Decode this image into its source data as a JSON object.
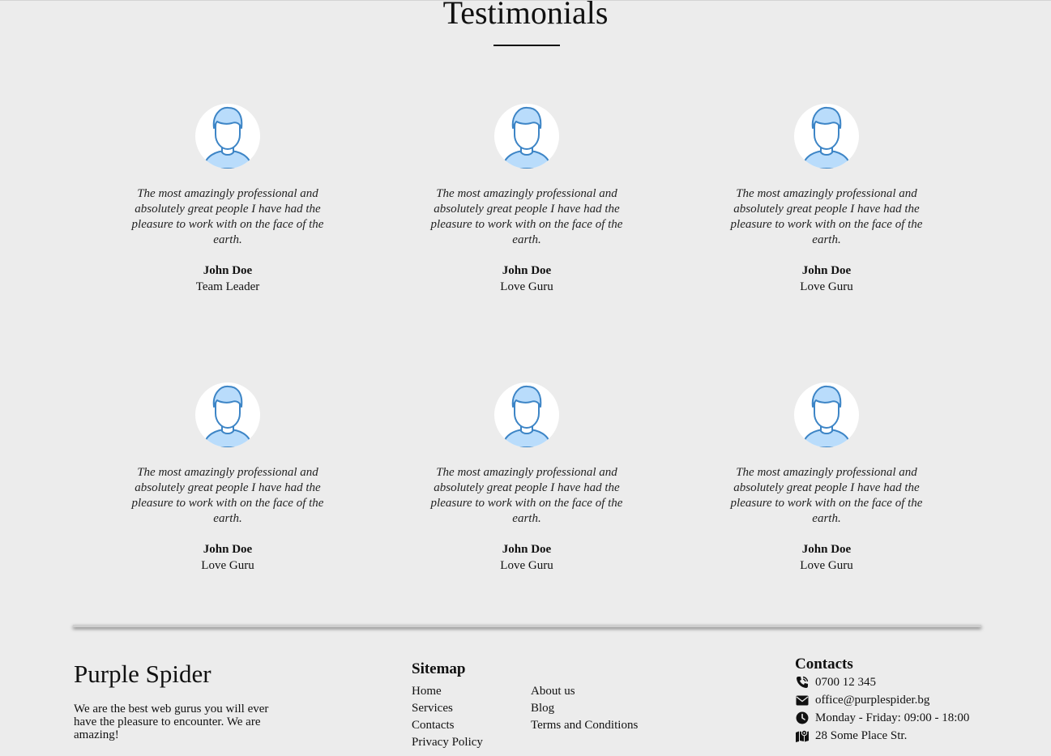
{
  "section": {
    "title": "Testimonials"
  },
  "testimonials": [
    {
      "icon": "user-avatar-icon",
      "quote": "The most amazingly professional and absolutely great people I have had the pleasure to work with on the face of the earth.",
      "name": "John Doe",
      "role": "Team Leader"
    },
    {
      "icon": "user-avatar-icon",
      "quote": "The most amazingly professional and absolutely great people I have had the pleasure to work with on the face of the earth.",
      "name": "John Doe",
      "role": "Love Guru"
    },
    {
      "icon": "user-avatar-icon",
      "quote": "The most amazingly professional and absolutely great people I have had the pleasure to work with on the face of the earth.",
      "name": "John Doe",
      "role": "Love Guru"
    },
    {
      "icon": "user-avatar-icon",
      "quote": "The most amazingly professional and absolutely great people I have had the pleasure to work with on the face of the earth.",
      "name": "John Doe",
      "role": "Love Guru"
    },
    {
      "icon": "user-avatar-icon",
      "quote": "The most amazingly professional and absolutely great people I have had the pleasure to work with on the face of the earth.",
      "name": "John Doe",
      "role": "Love Guru"
    },
    {
      "icon": "user-avatar-icon",
      "quote": "The most amazingly professional and absolutely great people I have had the pleasure to work with on the face of the earth.",
      "name": "John Doe",
      "role": "Love Guru"
    }
  ],
  "footer": {
    "brand": "Purple Spider",
    "tagline": "We are the best web gurus you will ever have the pleasure to encounter. We are amazing!",
    "sitemap": {
      "title": "Sitemap",
      "column1": [
        "Home",
        "Services",
        "Contacts",
        "Privacy Policy"
      ],
      "column2": [
        "About us",
        "Blog",
        "Terms and Conditions"
      ]
    },
    "contacts": {
      "title": "Contacts",
      "phone": "0700 12 345",
      "email": "office@purplespider.bg",
      "hours": "Monday - Friday: 09:00 - 18:00",
      "address": "28 Some Place Str."
    }
  },
  "colors": {
    "background": "#ececec",
    "avatar_fill": "#b9dcfb",
    "avatar_stroke": "#3d85c6",
    "text": "#111111"
  },
  "icons": {
    "phone": "phone-icon",
    "email": "envelope-icon",
    "hours": "clock-icon",
    "address": "map-icon"
  }
}
